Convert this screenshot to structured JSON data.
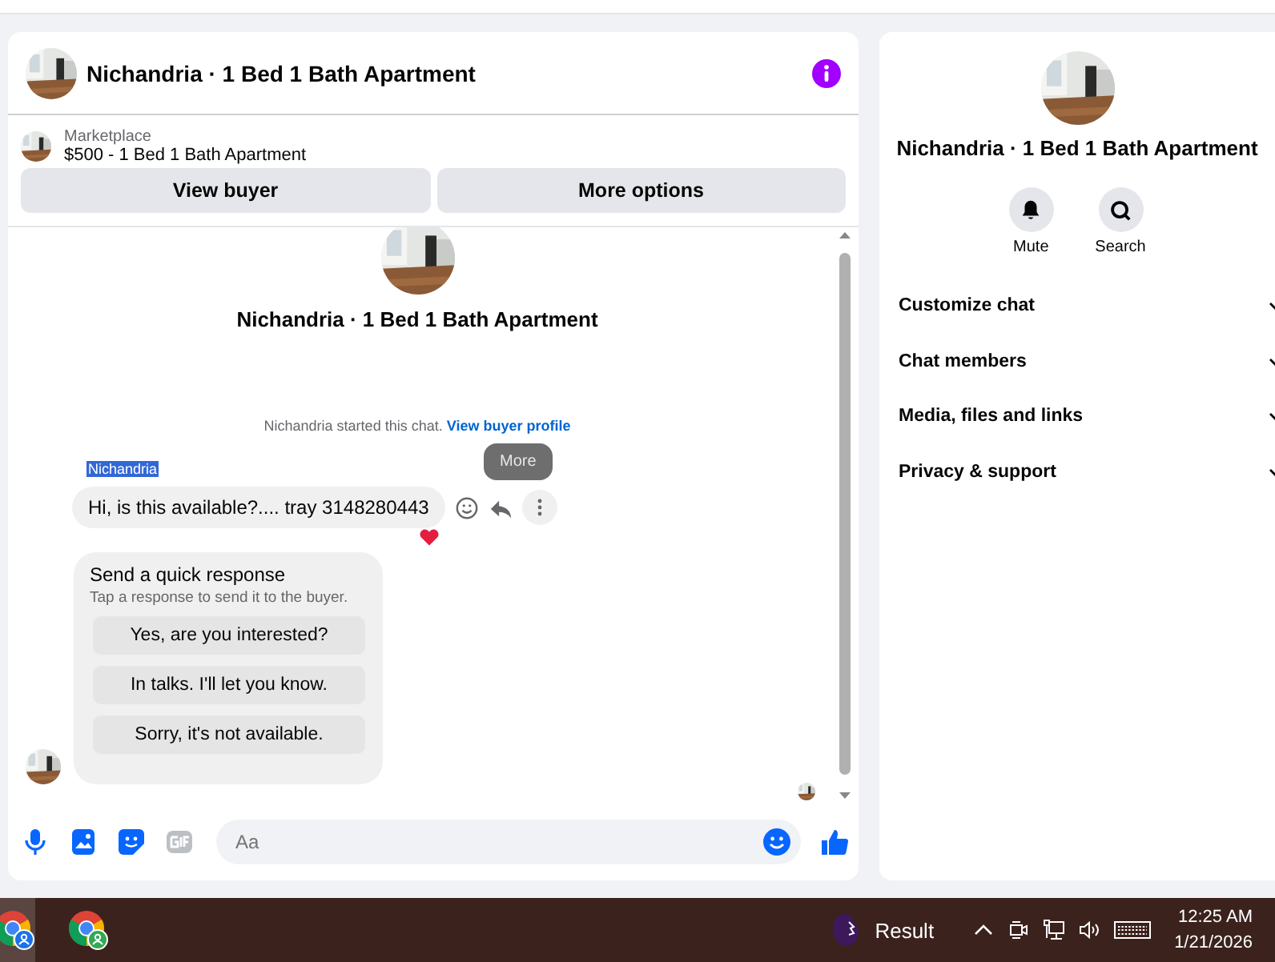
{
  "header": {
    "title": "Nichandria · 1 Bed 1 Bath Apartment"
  },
  "listing": {
    "label": "Marketplace",
    "title": "$500 - 1 Bed 1 Bath Apartment"
  },
  "actions": [
    "View buyer",
    "More options"
  ],
  "chat": {
    "title": "Nichandria · 1 Bed 1 Bath Apartment",
    "notice": "Nichandria started this chat.",
    "notice_link": "View buyer profile",
    "sender": {
      "name": "Nichandria",
      "highlighted": true
    },
    "message": "Hi, is this available?.... tray 3148280443",
    "tooltip": "More",
    "quick": {
      "title": "Send a quick response",
      "subtitle": "Tap a response to send it to the buyer.",
      "responses": [
        "Yes, are you interested?",
        "In talks. I'll let you know.",
        "Sorry, it's not available."
      ]
    }
  },
  "composer": {
    "placeholder": "Aa"
  },
  "details": {
    "title": "Nichandria · 1 Bed 1 Bath Apartment",
    "actions": [
      {
        "label": "Mute",
        "kind": "bell"
      },
      {
        "label": "Search",
        "kind": "search"
      }
    ],
    "sections": [
      "Customize chat",
      "Chat members",
      "Media, files and links",
      "Privacy & support"
    ]
  },
  "taskbar": {
    "weather": "Result",
    "time": "12:25 AM",
    "date": "1/21/2026"
  }
}
